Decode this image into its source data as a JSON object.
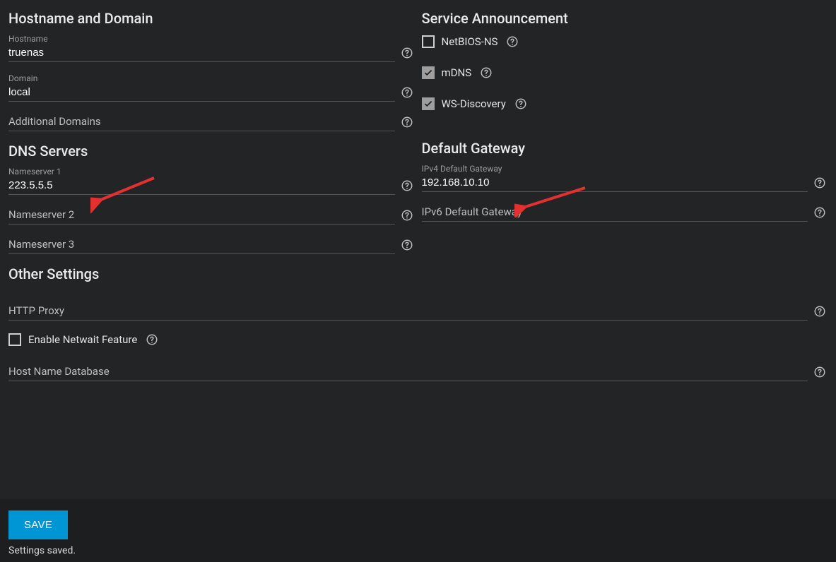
{
  "sections": {
    "hostname_domain": "Hostname and Domain",
    "service_announcement": "Service Announcement",
    "dns_servers": "DNS Servers",
    "default_gateway": "Default Gateway",
    "other_settings": "Other Settings"
  },
  "fields": {
    "hostname": {
      "label": "Hostname",
      "value": "truenas"
    },
    "domain": {
      "label": "Domain",
      "value": "local"
    },
    "additional_domains": {
      "label": "Additional Domains",
      "value": ""
    },
    "nameserver1": {
      "label": "Nameserver 1",
      "value": "223.5.5.5"
    },
    "nameserver2": {
      "label": "Nameserver 2",
      "value": ""
    },
    "nameserver3": {
      "label": "Nameserver 3",
      "value": ""
    },
    "ipv4_gateway": {
      "label": "IPv4 Default Gateway",
      "value": "192.168.10.10"
    },
    "ipv6_gateway": {
      "label": "IPv6 Default Gateway",
      "value": ""
    },
    "http_proxy": {
      "label": "HTTP Proxy",
      "value": ""
    },
    "hostname_db": {
      "label": "Host Name Database",
      "value": ""
    }
  },
  "checkboxes": {
    "netbios": {
      "label": "NetBIOS-NS",
      "checked": false
    },
    "mdns": {
      "label": "mDNS",
      "checked": true
    },
    "wsdiscovery": {
      "label": "WS-Discovery",
      "checked": true
    },
    "netwait": {
      "label": "Enable Netwait Feature",
      "checked": false
    }
  },
  "buttons": {
    "save": "SAVE"
  },
  "status": "Settings saved."
}
